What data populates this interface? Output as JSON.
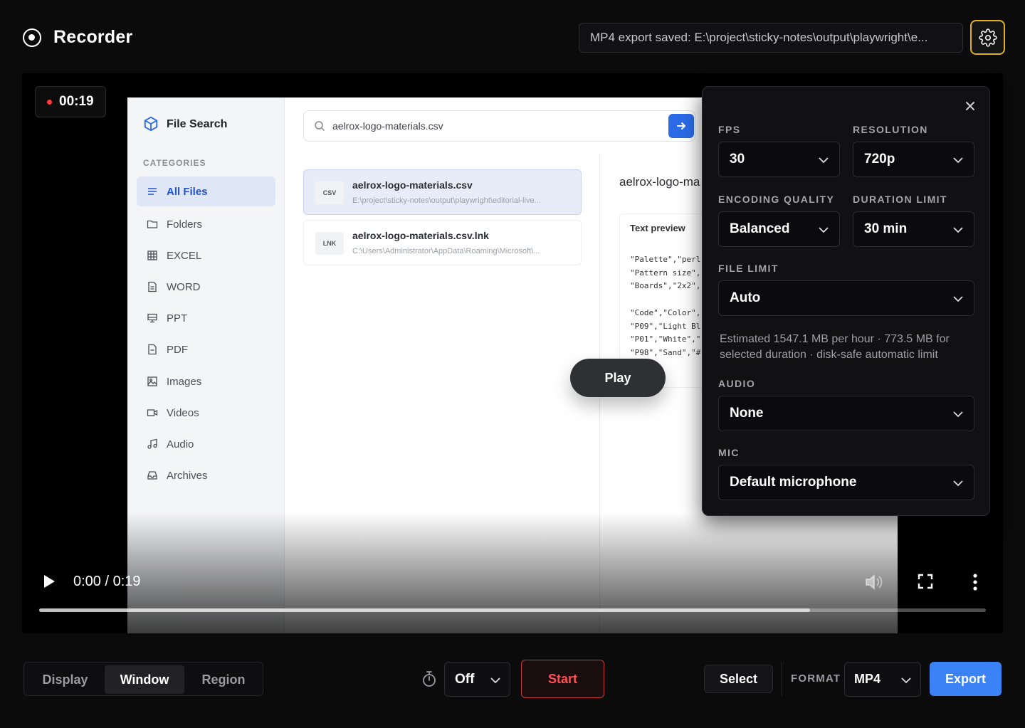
{
  "header": {
    "title": "Recorder",
    "status": "MP4 export saved: E:\\project\\sticky-notes\\output\\playwright\\e...",
    "settings_icon": "gear-icon",
    "accent": "#e0b021"
  },
  "video": {
    "elapsed": "00:19",
    "time_display": "0:00 / 0:19",
    "buffered_fraction": 0.814
  },
  "captured_app": {
    "title": "File Search",
    "categories_label": "CATEGORIES",
    "categories": [
      {
        "label": "All Files",
        "icon": "list-icon"
      },
      {
        "label": "Folders",
        "icon": "folder-icon"
      },
      {
        "label": "EXCEL",
        "icon": "grid-icon"
      },
      {
        "label": "WORD",
        "icon": "document-icon"
      },
      {
        "label": "PPT",
        "icon": "slides-icon"
      },
      {
        "label": "PDF",
        "icon": "document-icon"
      },
      {
        "label": "Images",
        "icon": "image-icon"
      },
      {
        "label": "Videos",
        "icon": "video-icon"
      },
      {
        "label": "Audio",
        "icon": "music-icon"
      },
      {
        "label": "Archives",
        "icon": "archive-icon"
      }
    ],
    "search_value": "aelrox-logo-materials.csv",
    "results": [
      {
        "type": "CSV",
        "name": "aelrox-logo-materials.csv",
        "path": "E:\\project\\sticky-notes\\output\\playwright\\editorial-live..."
      },
      {
        "type": "LNK",
        "name": "aelrox-logo-materials.csv.lnk",
        "path": "C:\\Users\\Administrator\\AppData\\Roaming\\Microsoft\\..."
      }
    ],
    "preview_title": "aelrox-logo-ma",
    "preview_header": "Text preview",
    "preview_text": "\"Palette\",\"perl\n\"Pattern size\",\n\"Boards\",\"2x2\",\n\n\"Code\",\"Color\",\n\"P09\",\"Light Bl\n\"P01\",\"White\",\"\n\"P98\",\"Sand\",\"#",
    "play_label": "Play"
  },
  "settings": {
    "fps_label": "FPS",
    "fps_value": "30",
    "resolution_label": "RESOLUTION",
    "resolution_value": "720p",
    "quality_label": "ENCODING QUALITY",
    "quality_value": "Balanced",
    "duration_label": "DURATION LIMIT",
    "duration_value": "30 min",
    "file_limit_label": "FILE LIMIT",
    "file_limit_value": "Auto",
    "estimate": "Estimated 1547.1 MB per hour · 773.5 MB for selected duration · disk-safe automatic limit",
    "audio_label": "AUDIO",
    "audio_value": "None",
    "mic_label": "MIC",
    "mic_value": "Default microphone"
  },
  "toolbar": {
    "modes": [
      "Display",
      "Window",
      "Region"
    ],
    "active_mode": "Window",
    "timer_value": "Off",
    "start_label": "Start",
    "select_label": "Select",
    "format_label": "FORMAT",
    "format_value": "MP4",
    "export_label": "Export",
    "start_color": "#ff4f55",
    "export_color": "#3b82f6"
  }
}
